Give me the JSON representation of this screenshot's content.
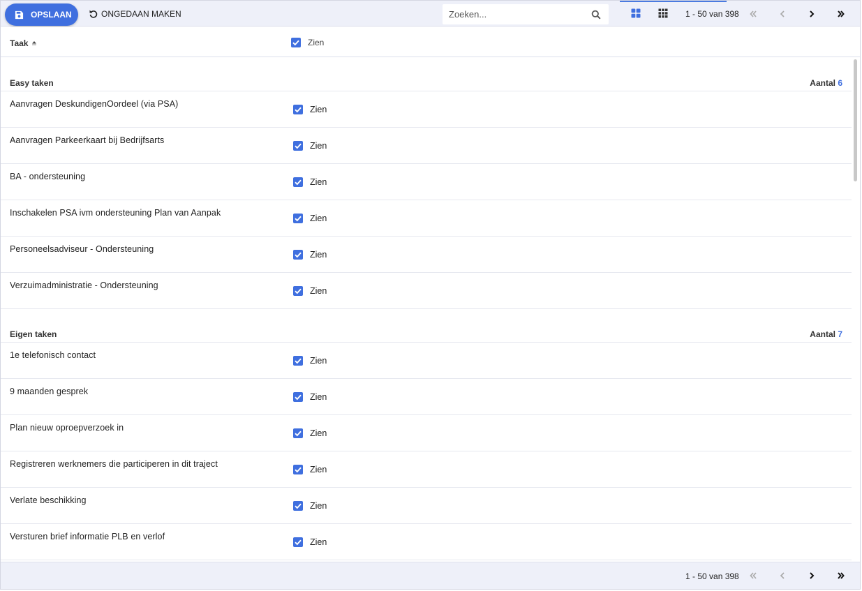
{
  "toolbar": {
    "save_label": "OPSLAAN",
    "undo_label": "ONGEDAAN MAKEN",
    "search_placeholder": "Zoeken...",
    "pager_text": "1 - 50 van 398"
  },
  "header": {
    "task_column": "Taak",
    "see_column": "Zien"
  },
  "groups": [
    {
      "title": "Easy taken",
      "count_label": "Aantal",
      "count": "6",
      "rows": [
        {
          "name": "Aanvragen DeskundigenOordeel (via PSA)",
          "see": "Zien"
        },
        {
          "name": "Aanvragen Parkeerkaart bij Bedrijfsarts",
          "see": "Zien"
        },
        {
          "name": "BA - ondersteuning",
          "see": "Zien"
        },
        {
          "name": "Inschakelen PSA ivm ondersteuning Plan van Aanpak",
          "see": "Zien"
        },
        {
          "name": "Personeelsadviseur - Ondersteuning",
          "see": "Zien"
        },
        {
          "name": "Verzuimadministratie - Ondersteuning",
          "see": "Zien"
        }
      ]
    },
    {
      "title": "Eigen taken",
      "count_label": "Aantal",
      "count": "7",
      "rows": [
        {
          "name": "1e telefonisch contact",
          "see": "Zien"
        },
        {
          "name": "9 maanden gesprek",
          "see": "Zien"
        },
        {
          "name": "Plan nieuw oproepverzoek in",
          "see": "Zien"
        },
        {
          "name": "Registreren werknemers die participeren in dit traject",
          "see": "Zien"
        },
        {
          "name": "Verlate beschikking",
          "see": "Zien"
        },
        {
          "name": "Versturen brief informatie PLB en verlof",
          "see": "Zien"
        }
      ]
    }
  ],
  "footer": {
    "pager_text": "1 - 50 van 398"
  },
  "colors": {
    "accent": "#3f6fdf",
    "toolbar_bg": "#eef0f9"
  }
}
